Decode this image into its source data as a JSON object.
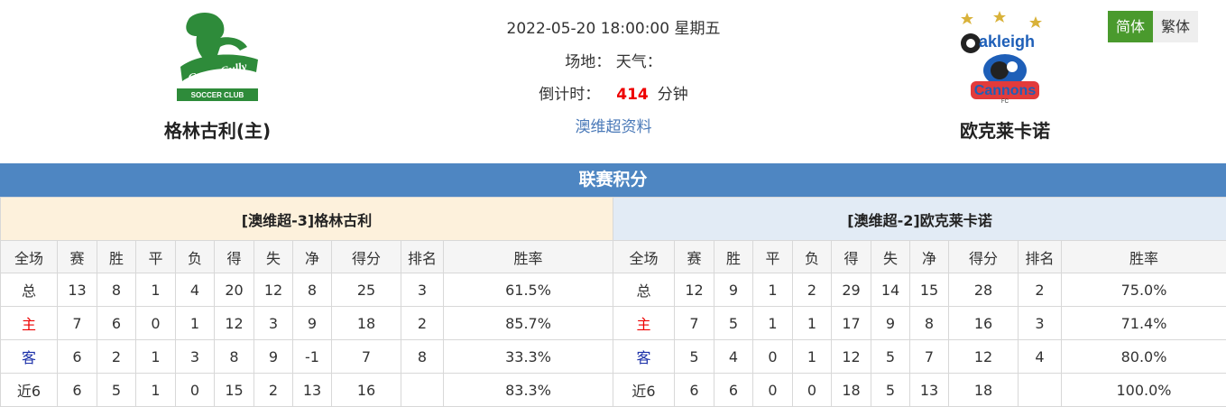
{
  "match": {
    "datetime": "2022-05-20 18:00:00 星期五",
    "venue_label": "场地：",
    "weather_label": "天气：",
    "countdown_label": "倒计时：",
    "countdown_value": "414",
    "countdown_unit": "分钟",
    "info_link": "澳维超资料"
  },
  "home_team": {
    "name": "格林古利(主)",
    "logo_text": "Green Gully",
    "logo_sub": "SOCCER CLUB"
  },
  "away_team": {
    "name": "欧克莱卡诺",
    "logo_text_top": "akleigh",
    "logo_text_bottom": "Cannons",
    "logo_fc": "FC"
  },
  "language": {
    "simplified": "简体",
    "traditional": "繁体"
  },
  "section_title": "联赛积分",
  "columns": [
    "全场",
    "赛",
    "胜",
    "平",
    "负",
    "得",
    "失",
    "净",
    "得分",
    "排名",
    "胜率"
  ],
  "left_table": {
    "title": "[澳维超-3]格林古利",
    "rows": [
      [
        "总",
        "13",
        "8",
        "1",
        "4",
        "20",
        "12",
        "8",
        "25",
        "3",
        "61.5%"
      ],
      [
        "主",
        "7",
        "6",
        "0",
        "1",
        "12",
        "3",
        "9",
        "18",
        "2",
        "85.7%"
      ],
      [
        "客",
        "6",
        "2",
        "1",
        "3",
        "8",
        "9",
        "-1",
        "7",
        "8",
        "33.3%"
      ],
      [
        "近6",
        "6",
        "5",
        "1",
        "0",
        "15",
        "2",
        "13",
        "16",
        "",
        "83.3%"
      ]
    ]
  },
  "right_table": {
    "title": "[澳维超-2]欧克莱卡诺",
    "rows": [
      [
        "总",
        "12",
        "9",
        "1",
        "2",
        "29",
        "14",
        "15",
        "28",
        "2",
        "75.0%"
      ],
      [
        "主",
        "7",
        "5",
        "1",
        "1",
        "17",
        "9",
        "8",
        "16",
        "3",
        "71.4%"
      ],
      [
        "客",
        "5",
        "4",
        "0",
        "1",
        "12",
        "5",
        "7",
        "12",
        "4",
        "80.0%"
      ],
      [
        "近6",
        "6",
        "6",
        "0",
        "0",
        "18",
        "5",
        "13",
        "18",
        "",
        "100.0%"
      ]
    ]
  },
  "colors": {
    "band": "#4e86c2",
    "home_label": "#e00000",
    "away_label": "#1a2fa8",
    "lang_active": "#4a9a2d"
  }
}
